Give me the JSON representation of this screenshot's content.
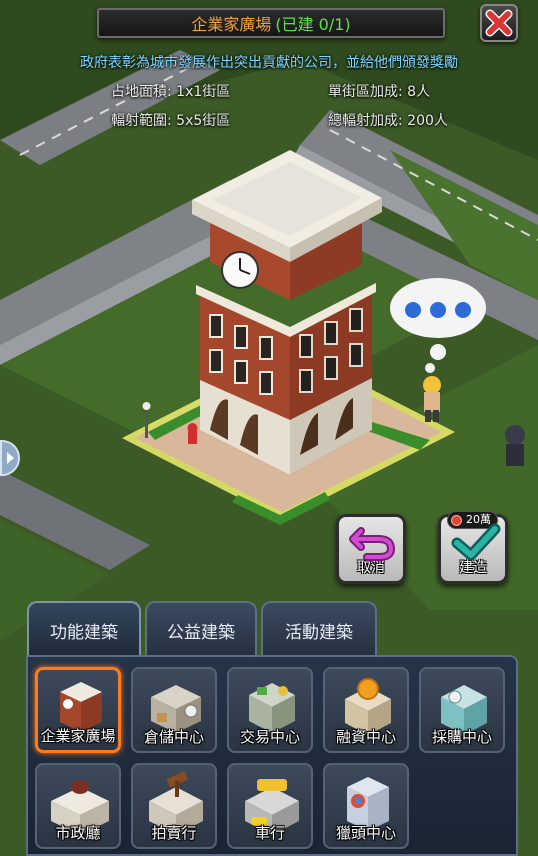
{
  "header": {
    "building_name": "企業家廣場",
    "build_status": "(已建 0/1)",
    "description": "政府表彰為城市發展作出突出貢獻的公司，並給他們頒發獎勵"
  },
  "stats": {
    "area": "占地面積: 1x1街區",
    "block_bonus": "單街區加成: 8人",
    "radius": "輻射範圍: 5x5街區",
    "total_bonus": "總輻射加成: 200人"
  },
  "actions": {
    "cancel_label": "取消",
    "build_label": "建造",
    "build_cost": "20萬"
  },
  "tabs": [
    {
      "label": "功能建築",
      "active": true
    },
    {
      "label": "公益建築",
      "active": false
    },
    {
      "label": "活動建築",
      "active": false
    }
  ],
  "buildings": [
    {
      "label": "企業家廣場",
      "icon": "brick-clocktower-icon",
      "selected": true
    },
    {
      "label": "倉儲中心",
      "icon": "warehouse-icon",
      "selected": false
    },
    {
      "label": "交易中心",
      "icon": "trade-center-icon",
      "selected": false
    },
    {
      "label": "融資中心",
      "icon": "finance-center-icon",
      "selected": false
    },
    {
      "label": "採購中心",
      "icon": "procurement-center-icon",
      "selected": false
    },
    {
      "label": "市政廳",
      "icon": "city-hall-icon",
      "selected": false
    },
    {
      "label": "拍賣行",
      "icon": "auction-house-icon",
      "selected": false
    },
    {
      "label": "車行",
      "icon": "car-dealer-icon",
      "selected": false
    },
    {
      "label": "獵頭中心",
      "icon": "headhunter-center-icon",
      "selected": false
    }
  ],
  "colors": {
    "title_accent": "#f0a13a",
    "status_green": "#5fe04a",
    "description_blue": "#7ed7ff",
    "selected_border": "#ff7a1a",
    "close_red": "#d93535"
  }
}
